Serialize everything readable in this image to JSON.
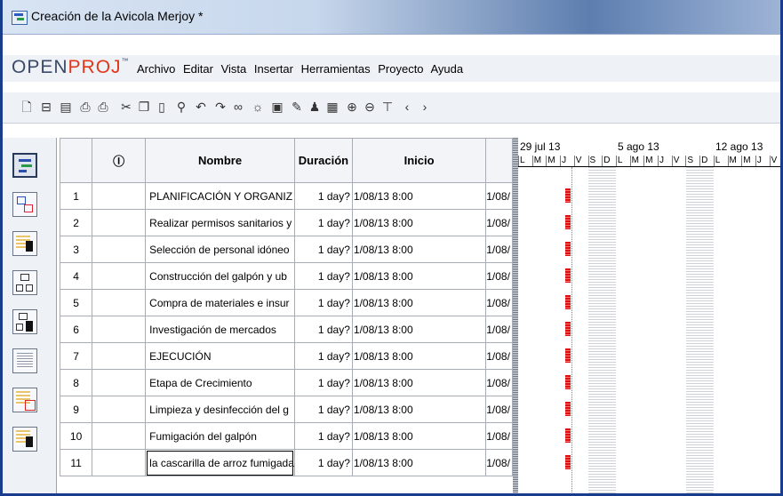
{
  "window": {
    "title": "Creación de la Avicola Merjoy *"
  },
  "brand": {
    "open": "OPEN",
    "proj": "PROJ",
    "tm": "™"
  },
  "menu": [
    "Archivo",
    "Editar",
    "Vista",
    "Insertar",
    "Herramientas",
    "Proyecto",
    "Ayuda"
  ],
  "toolbar_icons": [
    "new-file-icon",
    "open-folder-icon",
    "save-icon",
    "print-icon",
    "print-preview-icon",
    "cut-icon",
    "copy-icon",
    "paste-icon",
    "find-icon",
    "undo-icon",
    "redo-icon",
    "link-icon",
    "unlink-icon",
    "task-info-icon",
    "notes-icon",
    "resource-icon",
    "assign-resources-icon",
    "zoom-in-icon",
    "zoom-out-icon",
    "filter-icon",
    "scroll-left-icon",
    "scroll-right-icon"
  ],
  "sidebar_icons": [
    "gantt-view-icon",
    "network-view-icon",
    "resources-view-icon",
    "wbs-view-icon",
    "rbs-view-icon",
    "report-view-icon",
    "task-usage-icon",
    "resource-usage-icon"
  ],
  "table": {
    "headers": {
      "num": "",
      "ind": "Ⓘ",
      "name": "Nombre",
      "dur": "Duración",
      "start": "Inicio",
      "end": ""
    },
    "rows": [
      {
        "num": "1",
        "name": "PLANIFICACIÓN Y ORGANIZ",
        "dur": "1 day?",
        "start": "1/08/13 8:00",
        "end": "1/08/"
      },
      {
        "num": "2",
        "name": "Realizar permisos sanitarios y",
        "dur": "1 day?",
        "start": "1/08/13 8:00",
        "end": "1/08/"
      },
      {
        "num": "3",
        "name": "Selección de personal idóneo",
        "dur": "1 day?",
        "start": "1/08/13 8:00",
        "end": "1/08/"
      },
      {
        "num": "4",
        "name": "Construcción del galpón y ub",
        "dur": "1 day?",
        "start": "1/08/13 8:00",
        "end": "1/08/"
      },
      {
        "num": "5",
        "name": "Compra de materiales e insur",
        "dur": "1 day?",
        "start": "1/08/13 8:00",
        "end": "1/08/"
      },
      {
        "num": "6",
        "name": "Investigación de mercados",
        "dur": "1 day?",
        "start": "1/08/13 8:00",
        "end": "1/08/"
      },
      {
        "num": "7",
        "name": "EJECUCIÓN",
        "dur": "1 day?",
        "start": "1/08/13 8:00",
        "end": "1/08/"
      },
      {
        "num": "8",
        "name": "Etapa de Crecimiento",
        "dur": "1 day?",
        "start": "1/08/13 8:00",
        "end": "1/08/"
      },
      {
        "num": "9",
        "name": "Limpieza y desinfección del g",
        "dur": "1 day?",
        "start": "1/08/13 8:00",
        "end": "1/08/"
      },
      {
        "num": "10",
        "name": "Fumigación del galpón",
        "dur": "1 day?",
        "start": "1/08/13 8:00",
        "end": "1/08/"
      },
      {
        "num": "11",
        "name": "la cascarilla de arroz fumigada",
        "dur": "1 day?",
        "start": "1/08/13 8:00",
        "end": "1/08/"
      }
    ]
  },
  "gantt": {
    "weeks": [
      "29 jul 13",
      "5 ago 13",
      "12 ago 13"
    ],
    "days": [
      "L",
      "M",
      "M",
      "J",
      "V",
      "S",
      "D",
      "L",
      "M",
      "M",
      "J",
      "V",
      "S",
      "D",
      "L",
      "M",
      "M",
      "J",
      "V"
    ],
    "bar_color": "#e01010"
  }
}
